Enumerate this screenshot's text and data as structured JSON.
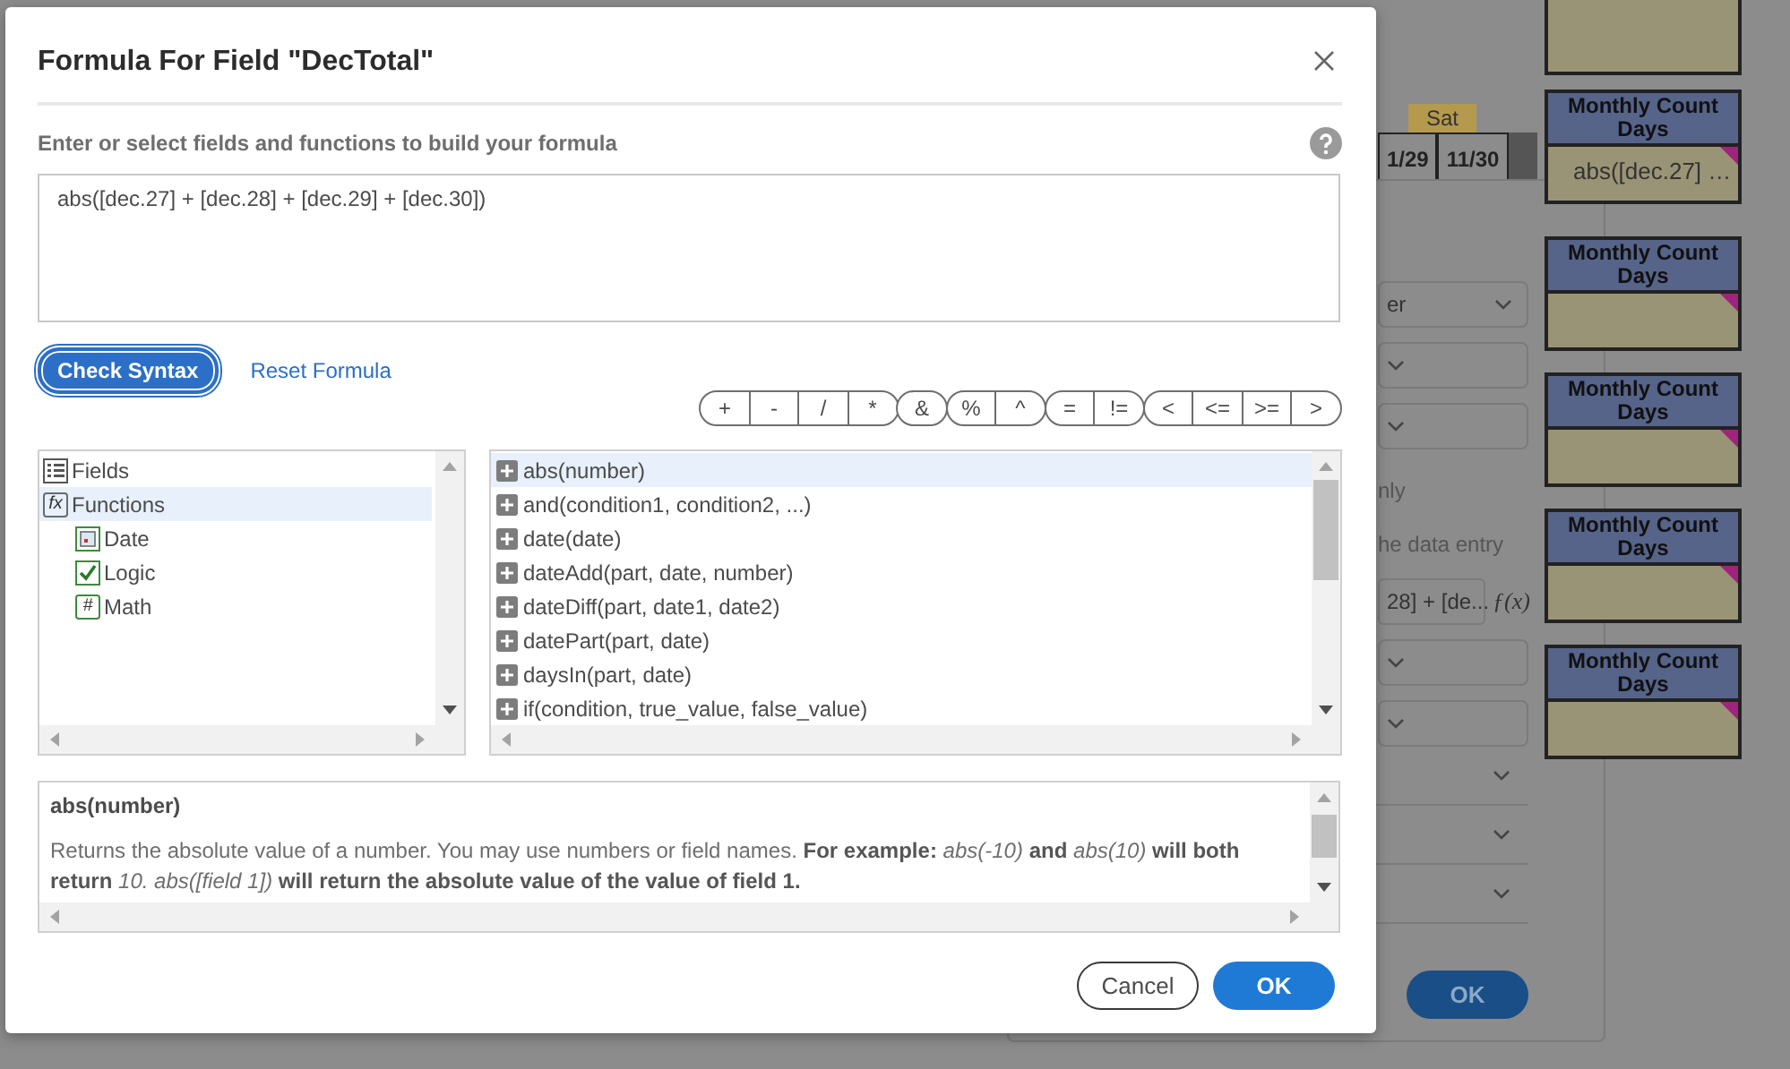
{
  "background": {
    "calendar": {
      "day": "Sat",
      "dates": [
        "1/29",
        "11/30"
      ]
    },
    "cards": [
      {
        "kind": "body_only"
      },
      {
        "header": "Monthly Count Days",
        "value": "abs([dec.27] …"
      },
      {
        "header": "Monthly Count Days"
      },
      {
        "header": "Monthly Count Days"
      },
      {
        "header": "Monthly Count Days"
      },
      {
        "header": "Monthly Count Days"
      }
    ],
    "panel": {
      "select_text": "er",
      "note_1": "nly",
      "note_2": "he data entry",
      "formula_value": "28] + [de...",
      "formula_glyph": "ƒ(x)",
      "ok": "OK"
    }
  },
  "dialog": {
    "title": "Formula For Field \"DecTotal\"",
    "instruction": "Enter or select fields and functions to build your formula",
    "formula": "abs([dec.27] + [dec.28] + [dec.29] + [dec.30])",
    "check_syntax": "Check Syntax",
    "reset_formula": "Reset Formula",
    "operator_groups": [
      [
        "+",
        "-",
        "/",
        "*"
      ],
      [
        "&"
      ],
      [
        "%",
        "^"
      ],
      [
        "=",
        "!="
      ],
      [
        "<",
        "<=",
        ">=",
        ">"
      ]
    ],
    "tree": [
      {
        "label": "Fields",
        "kind": "fields",
        "selected": false
      },
      {
        "label": "Functions",
        "kind": "functions",
        "glyph": "fx",
        "selected": true,
        "children": [
          {
            "label": "Date",
            "kind": "date",
            "selected": false
          },
          {
            "label": "Logic",
            "kind": "logic",
            "selected": false
          },
          {
            "label": "Math",
            "kind": "math",
            "glyph": "#",
            "selected": false
          }
        ]
      }
    ],
    "functions": [
      {
        "label": "abs(number)",
        "selected": true
      },
      {
        "label": "and(condition1, condition2, ...)",
        "selected": false
      },
      {
        "label": "date(date)",
        "selected": false
      },
      {
        "label": "dateAdd(part, date, number)",
        "selected": false
      },
      {
        "label": "dateDiff(part, date1, date2)",
        "selected": false
      },
      {
        "label": "datePart(part, date)",
        "selected": false
      },
      {
        "label": "daysIn(part, date)",
        "selected": false
      },
      {
        "label": "if(condition, true_value, false_value)",
        "selected": false
      }
    ],
    "description": {
      "title": "abs(number)",
      "text": "Returns the absolute value of a number. You may use numbers or field names.  **For example:** *abs(-10)* **and** *abs(10)* **will both return** *10. abs([field 1])* **will return the absolute value of the value of field 1.**"
    },
    "buttons": {
      "cancel": "Cancel",
      "ok": "OK"
    }
  }
}
